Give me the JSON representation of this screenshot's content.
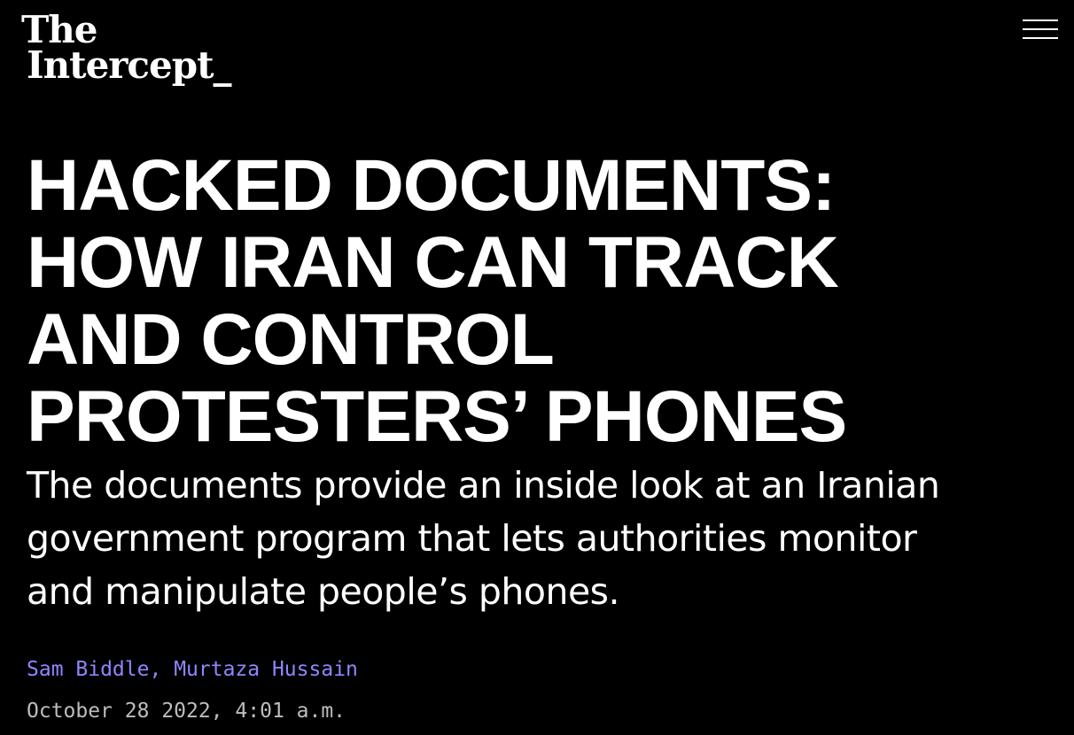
{
  "header": {
    "logo_line1": "The",
    "logo_line2": "Intercept_",
    "menu_icon": "hamburger-menu-icon"
  },
  "article": {
    "headline": "Hacked Documents: How Iran Can Track and Control Protesters’ Phones",
    "dek": "The documents provide an inside look at an Iranian government program that lets authorities monitor and manipulate people’s phones.",
    "authors": [
      "Sam Biddle",
      "Murtaza Hussain"
    ],
    "author_separator": ", ",
    "date": "October 28 2022, 4:01 a.m."
  },
  "colors": {
    "background": "#000000",
    "text": "#ffffff",
    "author_link": "#8f86ff",
    "date": "#bdbdbd"
  }
}
